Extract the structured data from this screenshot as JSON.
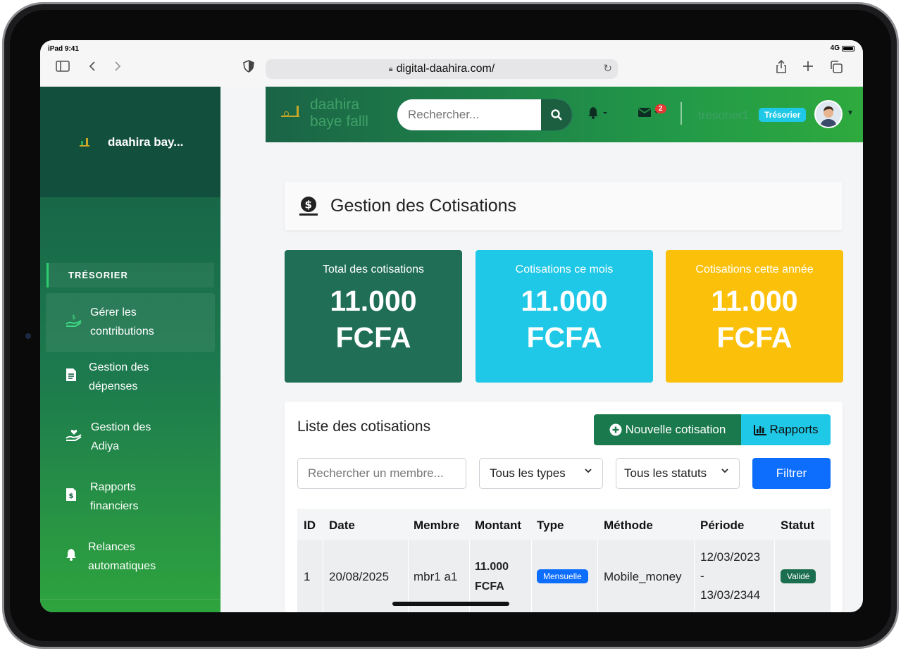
{
  "device": {
    "status_time": "iPad 9:41",
    "network": "4G"
  },
  "browser": {
    "url": "digital-daahira.com/"
  },
  "sidebar": {
    "brand": "daahira bay...",
    "section_label": "TRÉSORIER",
    "items": [
      {
        "line1": "Gérer les",
        "line2": "contributions",
        "icon": "hand-money-icon",
        "active": true
      },
      {
        "line1": "Gestion des",
        "line2": "dépenses",
        "icon": "receipt-icon",
        "active": false
      },
      {
        "line1": "Gestion des",
        "line2": "Adiya",
        "icon": "hand-heart-icon",
        "active": false
      },
      {
        "line1": "Rapports",
        "line2": "financiers",
        "icon": "invoice-dollar-icon",
        "active": false
      },
      {
        "line1": "Relances",
        "line2": "automatiques",
        "icon": "bell-icon",
        "active": false
      }
    ]
  },
  "topnav": {
    "title_line1": "daahira",
    "title_line2": "baye falll",
    "search_placeholder": "Rechercher...",
    "messages_badge": "2",
    "username": "tresorier1",
    "role": "Trésorier"
  },
  "page": {
    "title": "Gestion des Cotisations"
  },
  "stats": [
    {
      "title": "Total des cotisations",
      "value_line1": "11.000",
      "value_line2": "FCFA",
      "color": "#1f6e55"
    },
    {
      "title": "Cotisations ce mois",
      "value_line1": "11.000",
      "value_line2": "FCFA",
      "color": "#1ec8e6"
    },
    {
      "title": "Cotisations cette année",
      "value_line1": "11.000",
      "value_line2": "FCFA",
      "color": "#fbc10a"
    }
  ],
  "list": {
    "title": "Liste des cotisations",
    "new_button": "Nouvelle cotisation",
    "reports_button": "Rapports",
    "search_placeholder": "Rechercher un membre...",
    "type_select": "Tous les types",
    "status_select": "Tous les statuts",
    "filter_button": "Filtrer",
    "columns": [
      "ID",
      "Date",
      "Membre",
      "Montant",
      "Type",
      "Méthode",
      "Période",
      "Statut"
    ],
    "rows": [
      {
        "id": "1",
        "date": "20/08/2025",
        "member": "mbr1 a1",
        "amount_line1": "11.000",
        "amount_line2": "FCFA",
        "type": "Mensuelle",
        "method": "Mobile_money",
        "period_line1": "12/03/2023",
        "period_line2": "-",
        "period_line3": "13/03/2344",
        "status": "Validé"
      }
    ]
  }
}
